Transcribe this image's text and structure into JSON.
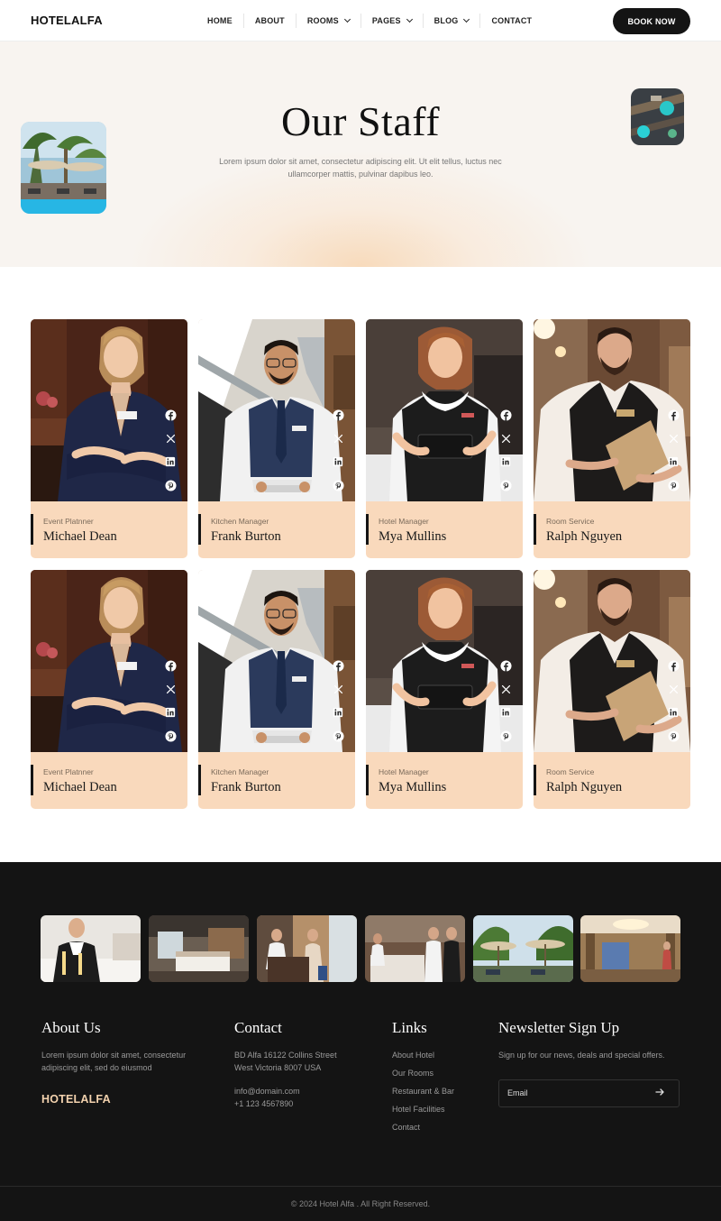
{
  "header": {
    "logo": "HOTELALFA",
    "nav": [
      {
        "label": "HOME",
        "dropdown": false
      },
      {
        "label": "ABOUT",
        "dropdown": false
      },
      {
        "label": "ROOMS",
        "dropdown": true
      },
      {
        "label": "PAGES",
        "dropdown": true
      },
      {
        "label": "BLOG",
        "dropdown": true
      },
      {
        "label": "CONTACT",
        "dropdown": false
      }
    ],
    "cta": "BOOK NOW"
  },
  "hero": {
    "title": "Our Staff",
    "subtitle": "Lorem ipsum dolor sit amet, consectetur adipiscing elit. Ut elit tellus, luctus nec ullamcorper mattis, pulvinar dapibus leo."
  },
  "staff": [
    {
      "role": "Event Platnner",
      "name": "Michael Dean"
    },
    {
      "role": "Kitchen Manager",
      "name": "Frank Burton"
    },
    {
      "role": "Hotel Manager",
      "name": "Mya Mullins"
    },
    {
      "role": "Room Service",
      "name": "Ralph Nguyen"
    },
    {
      "role": "Event Platnner",
      "name": "Michael Dean"
    },
    {
      "role": "Kitchen Manager",
      "name": "Frank Burton"
    },
    {
      "role": "Hotel Manager",
      "name": "Mya Mullins"
    },
    {
      "role": "Room Service",
      "name": "Ralph Nguyen"
    }
  ],
  "social_icons": [
    "facebook-icon",
    "x-icon",
    "linkedin-icon",
    "pinterest-icon"
  ],
  "footer": {
    "about": {
      "title": "About Us",
      "text": "Lorem ipsum dolor sit amet, consectetur adipiscing elit, sed do eiusmod",
      "logo": "HOTELALFA"
    },
    "contact": {
      "title": "Contact",
      "address_line1": "BD Alfa 16122 Collins Street",
      "address_line2": "West Victoria 8007 USA",
      "email": "info@domain.com",
      "phone": "+1 123 4567890"
    },
    "links": {
      "title": "Links",
      "items": [
        "About Hotel",
        "Our Rooms",
        "Restaurant & Bar",
        "Hotel Facilities",
        "Contact"
      ]
    },
    "newsletter": {
      "title": "Newsletter Sign Up",
      "text": "Sign up for our news, deals and special offers.",
      "email_placeholder": "Email"
    },
    "copyright": "© 2024 Hotel Alfa . All Right Reserved."
  },
  "colors": {
    "accent": "#f9d9bc",
    "dark": "#141414",
    "footer_logo": "#f3d2ae",
    "hero_bg": "#f8f4f0"
  }
}
